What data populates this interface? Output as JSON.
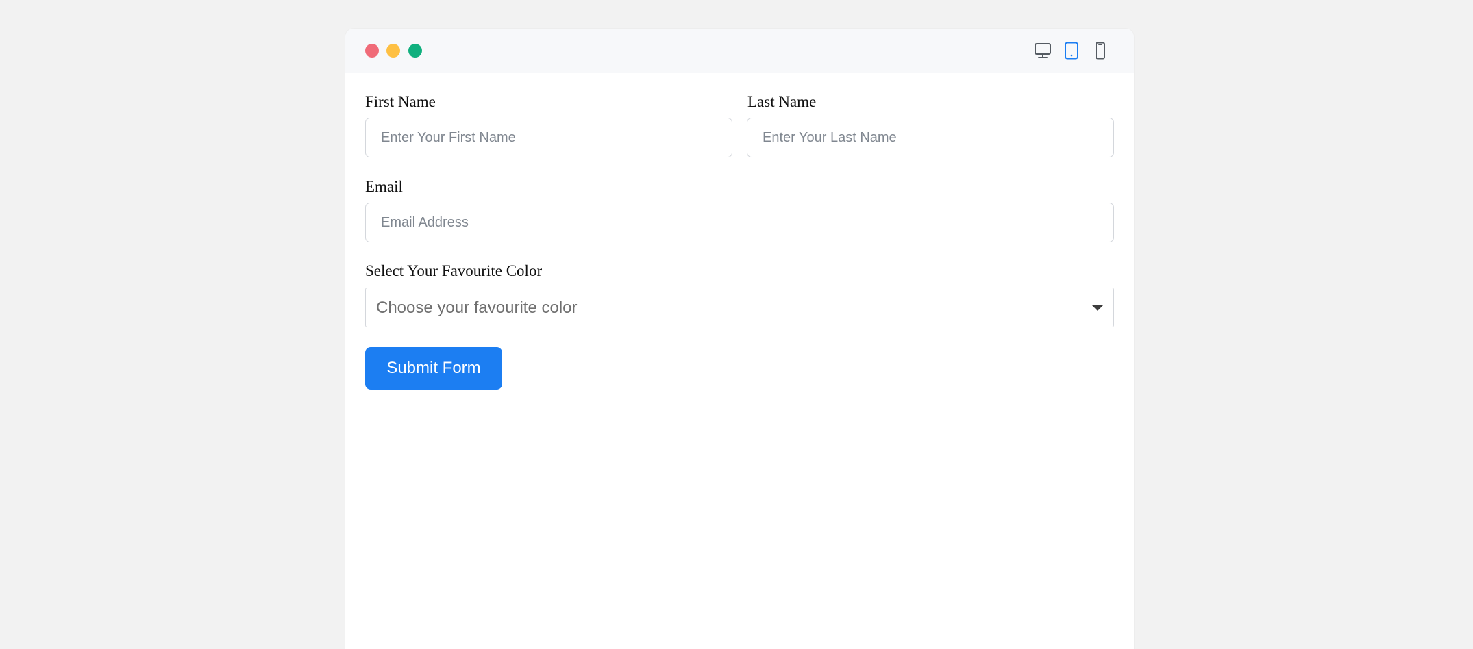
{
  "colors": {
    "page_background": "#f2f2f2",
    "window_background": "#ffffff",
    "titlebar_background": "#f7f8fa",
    "red_dot": "#f06b78",
    "yellow_dot": "#fec043",
    "green_dot": "#10b07e",
    "active_icon": "#1c7ef2",
    "inactive_icon": "#555b62",
    "submit_button": "#1c7ef2"
  },
  "toolbar": {
    "traffic_lights": [
      "red-dot",
      "yellow-dot",
      "green-dot"
    ],
    "view_modes": [
      {
        "icon": "desktop-icon",
        "active": false
      },
      {
        "icon": "tablet-icon",
        "active": true
      },
      {
        "icon": "mobile-icon",
        "active": false
      }
    ]
  },
  "form": {
    "first_name": {
      "label": "First Name",
      "placeholder": "Enter Your First Name",
      "value": ""
    },
    "last_name": {
      "label": "Last Name",
      "placeholder": "Enter Your Last Name",
      "value": ""
    },
    "email": {
      "label": "Email",
      "placeholder": "Email Address",
      "value": ""
    },
    "favourite_color": {
      "label": "Select Your Favourite Color",
      "selected": "Choose your favourite color"
    },
    "submit_label": "Submit Form"
  }
}
